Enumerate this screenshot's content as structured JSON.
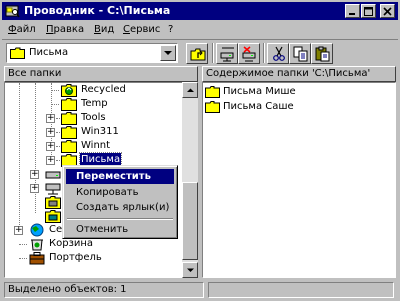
{
  "window": {
    "title": "Проводник - C:\\Письма",
    "minimize_label": "_",
    "maximize_label": "□",
    "close_label": "×"
  },
  "menu": {
    "items": [
      {
        "label": "Файл"
      },
      {
        "label": "Правка"
      },
      {
        "label": "Вид"
      },
      {
        "label": "Сервис"
      },
      {
        "label": "?"
      }
    ]
  },
  "toolbar": {
    "address_value": "Письма",
    "buttons": [
      {
        "icon": "up-folder-icon"
      },
      {
        "icon": "map-drive-icon"
      },
      {
        "icon": "disconnect-drive-icon"
      },
      {
        "icon": "cut-icon"
      },
      {
        "icon": "copy-icon"
      },
      {
        "icon": "paste-icon"
      }
    ]
  },
  "left_pane": {
    "header": "Все папки",
    "tree": [
      {
        "label": "Recycled",
        "icon": "recycle-folder-icon",
        "expander": ""
      },
      {
        "label": "Temp",
        "icon": "folder-icon",
        "expander": ""
      },
      {
        "label": "Tools",
        "icon": "folder-icon",
        "expander": "+"
      },
      {
        "label": "Win311",
        "icon": "folder-icon",
        "expander": "+"
      },
      {
        "label": "Winnt",
        "icon": "folder-icon",
        "expander": "+"
      },
      {
        "label": "Письма",
        "icon": "folder-icon",
        "expander": "+",
        "selected": true
      },
      {
        "label": "",
        "icon": "drive-icon",
        "expander": "+"
      },
      {
        "label": "",
        "icon": "network-icon",
        "expander": "+"
      },
      {
        "label": "",
        "icon": "printer-icon",
        "expander": ""
      },
      {
        "label": "",
        "icon": "folder-icon",
        "expander": ""
      },
      {
        "label": "Сете",
        "icon": "network-neighborhood-icon",
        "expander": "+"
      },
      {
        "label": "Корзина",
        "icon": "recycle-bin-icon",
        "expander": ""
      },
      {
        "label": "Портфель",
        "icon": "briefcase-icon",
        "expander": ""
      }
    ]
  },
  "right_pane": {
    "header": "Содержимое папки 'C:\\Письма'",
    "files": [
      {
        "label": "Письма Мише",
        "icon": "folder-icon"
      },
      {
        "label": "Письма Саше",
        "icon": "folder-icon"
      }
    ]
  },
  "context_menu": {
    "items": [
      {
        "label": "Переместить",
        "active": true
      },
      {
        "label": "Копировать"
      },
      {
        "label": "Создать ярлык(и)"
      },
      {
        "label": "Отменить"
      }
    ]
  },
  "statusbar": {
    "text": "Выделено объектов: 1"
  },
  "colors": {
    "titlebar": "#000080",
    "face": "#c0c0c0",
    "folder": "#ffff00",
    "selection": "#000080"
  }
}
